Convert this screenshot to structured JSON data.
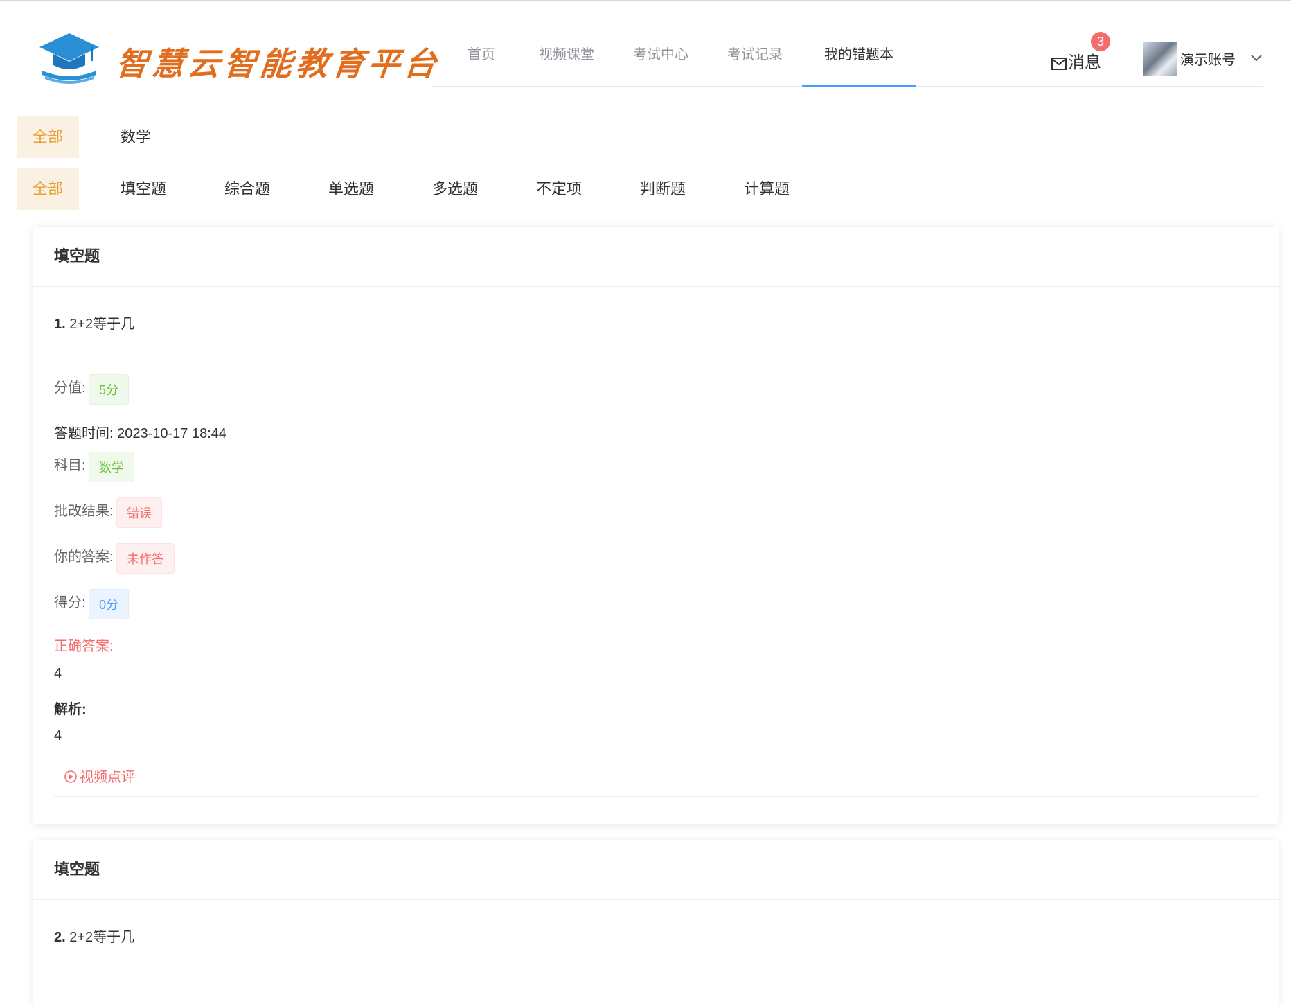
{
  "brand": "智慧云智能教育平台",
  "nav": [
    "首页",
    "视频课堂",
    "考试中心",
    "考试记录",
    "我的错题本"
  ],
  "messages": {
    "label": "消息",
    "count": "3"
  },
  "user": {
    "name": "演示账号"
  },
  "subjects": {
    "all": "全部",
    "items": [
      "数学"
    ]
  },
  "types": {
    "all": "全部",
    "items": [
      "填空题",
      "综合题",
      "单选题",
      "多选题",
      "不定项",
      "判断题",
      "计算题"
    ]
  },
  "cards": [
    {
      "section": "填空题",
      "number": "1.",
      "question": "2+2等于几",
      "score_label": "分值:",
      "score": "5分",
      "time_label": "答题时间:",
      "time": "2023-10-17 18:44",
      "subject_label": "科目:",
      "subject": "数学",
      "result_label": "批改结果:",
      "result": "错误",
      "answer_label": "你的答案:",
      "answer": "未作答",
      "got_label": "得分:",
      "got": "0分",
      "correct_label": "正确答案:",
      "correct": "4",
      "analysis_label": "解析:",
      "analysis": "4",
      "video": "视频点评"
    },
    {
      "section": "填空题",
      "number": "2.",
      "question": "2+2等于几"
    }
  ]
}
